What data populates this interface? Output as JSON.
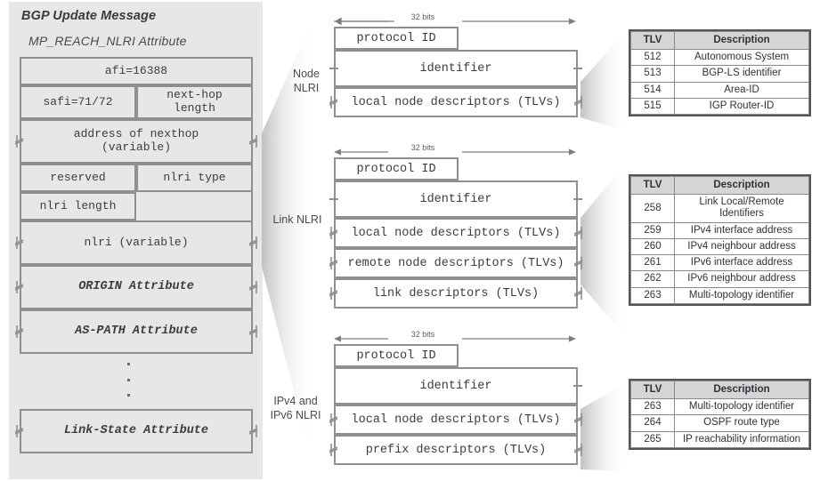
{
  "left_panel": {
    "title": "BGP Update Message",
    "subtitle": "MP_REACH_NLRI Attribute",
    "fields": [
      {
        "label": "afi=16388"
      },
      {
        "label": "safi=71/72"
      },
      {
        "label": "next-hop\nlength"
      },
      {
        "label": "address of nexthop\n(variable)"
      },
      {
        "label": "reserved"
      },
      {
        "label": "nlri type"
      },
      {
        "label": "nlri length"
      },
      {
        "label": "nlri (variable)"
      },
      {
        "label": "ORIGIN Attribute"
      },
      {
        "label": "AS-PATH Attribute"
      },
      {
        "label": "Link-State Attribute"
      }
    ],
    "ellipsis": "···"
  },
  "middle": {
    "width_label": "32 bits",
    "groups": [
      {
        "name": "Node NLRI",
        "label_lines": [
          "Node",
          "NLRI"
        ],
        "rows": [
          "protocol ID",
          "identifier",
          "local node descriptors (TLVs)"
        ]
      },
      {
        "name": "Link NLRI",
        "label_lines": [
          "Link NLRI"
        ],
        "rows": [
          "protocol ID",
          "identifier",
          "local node descriptors (TLVs)",
          "remote node descriptors (TLVs)",
          "link descriptors (TLVs)"
        ]
      },
      {
        "name": "IPv4 and IPv6 NLRI",
        "label_lines": [
          "IPv4 and",
          "IPv6 NLRI"
        ],
        "rows": [
          "protocol ID",
          "identifier",
          "local node descriptors (TLVs)",
          "prefix descriptors (TLVs)"
        ]
      }
    ]
  },
  "tables": [
    {
      "headers": [
        "TLV",
        "Description"
      ],
      "rows": [
        [
          "512",
          "Autonomous System"
        ],
        [
          "513",
          "BGP-LS identifier"
        ],
        [
          "514",
          "Area-ID"
        ],
        [
          "515",
          "IGP Router-ID"
        ]
      ]
    },
    {
      "headers": [
        "TLV",
        "Description"
      ],
      "rows": [
        [
          "258",
          "Link Local/Remote Identifiers"
        ],
        [
          "259",
          "IPv4 interface address"
        ],
        [
          "260",
          "IPv4 neighbour address"
        ],
        [
          "261",
          "IPv6 interface address"
        ],
        [
          "262",
          "IPv6 neighbour address"
        ],
        [
          "263",
          "Multi-topology identifier"
        ]
      ]
    },
    {
      "headers": [
        "TLV",
        "Description"
      ],
      "rows": [
        [
          "263",
          "Multi-topology identifier"
        ],
        [
          "264",
          "OSPF route type"
        ],
        [
          "265",
          "IP reachability information"
        ]
      ]
    }
  ],
  "colors": {
    "panel_bg": "#e7e7e7",
    "box_border": "#8f8f8f",
    "table_border": "#555555",
    "table_header_bg": "#d5d5d5",
    "text": "#3c3c3c"
  }
}
